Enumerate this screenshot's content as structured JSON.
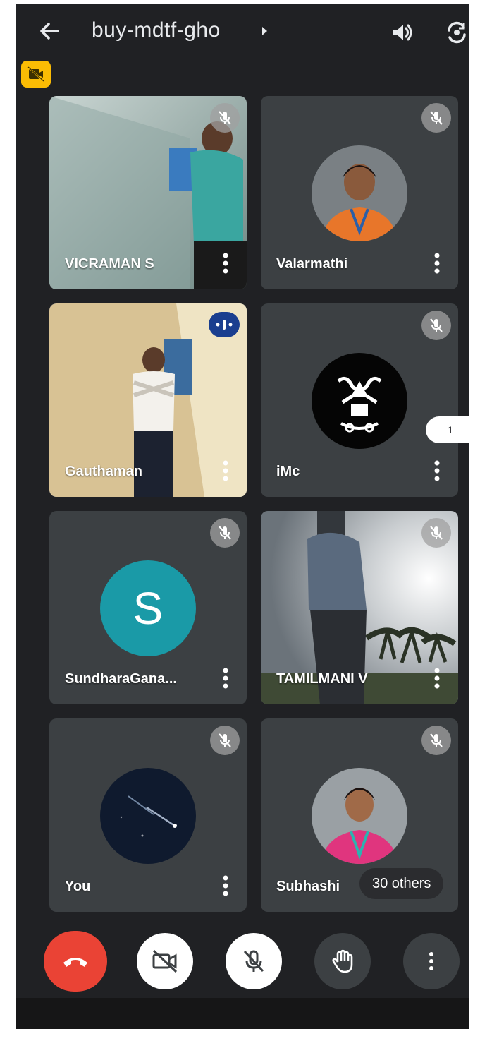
{
  "header": {
    "meeting_code": "buy-mdtf-gho"
  },
  "participants": [
    {
      "name": "VICRAMAN S",
      "muted": true,
      "video": true
    },
    {
      "name": "Valarmathi",
      "muted": true,
      "video": false
    },
    {
      "name": "Gauthaman",
      "muted": false,
      "speaking": true,
      "video": true
    },
    {
      "name": "iMc",
      "muted": true,
      "video": false
    },
    {
      "name": "SundharaGana...",
      "muted": true,
      "video": false,
      "initial": "S"
    },
    {
      "name": "TAMILMANI V",
      "muted": true,
      "video": true
    },
    {
      "name": "You",
      "muted": true,
      "video": false
    },
    {
      "name": "Subhashi",
      "muted": true,
      "video": false
    }
  ],
  "overflow": {
    "others_label": "30 others"
  },
  "side_badge": {
    "count": "1"
  },
  "colors": {
    "background": "#202124",
    "tile": "#3c4043",
    "end_call": "#ea4335",
    "record_badge": "#fbbc04",
    "speaking_indicator": "#1a3e8f",
    "letter_avatar": "#1a9aa7"
  },
  "icons": {
    "back": "arrow-left-icon",
    "speaker": "speaker-icon",
    "camera_flip": "camera-flip-icon",
    "recording": "camera-off-badge-icon",
    "end_call": "phone-hangup-icon",
    "camera": "camera-off-icon",
    "microphone": "mic-off-icon",
    "hand": "hand-raise-icon",
    "more": "more-vert-icon"
  }
}
